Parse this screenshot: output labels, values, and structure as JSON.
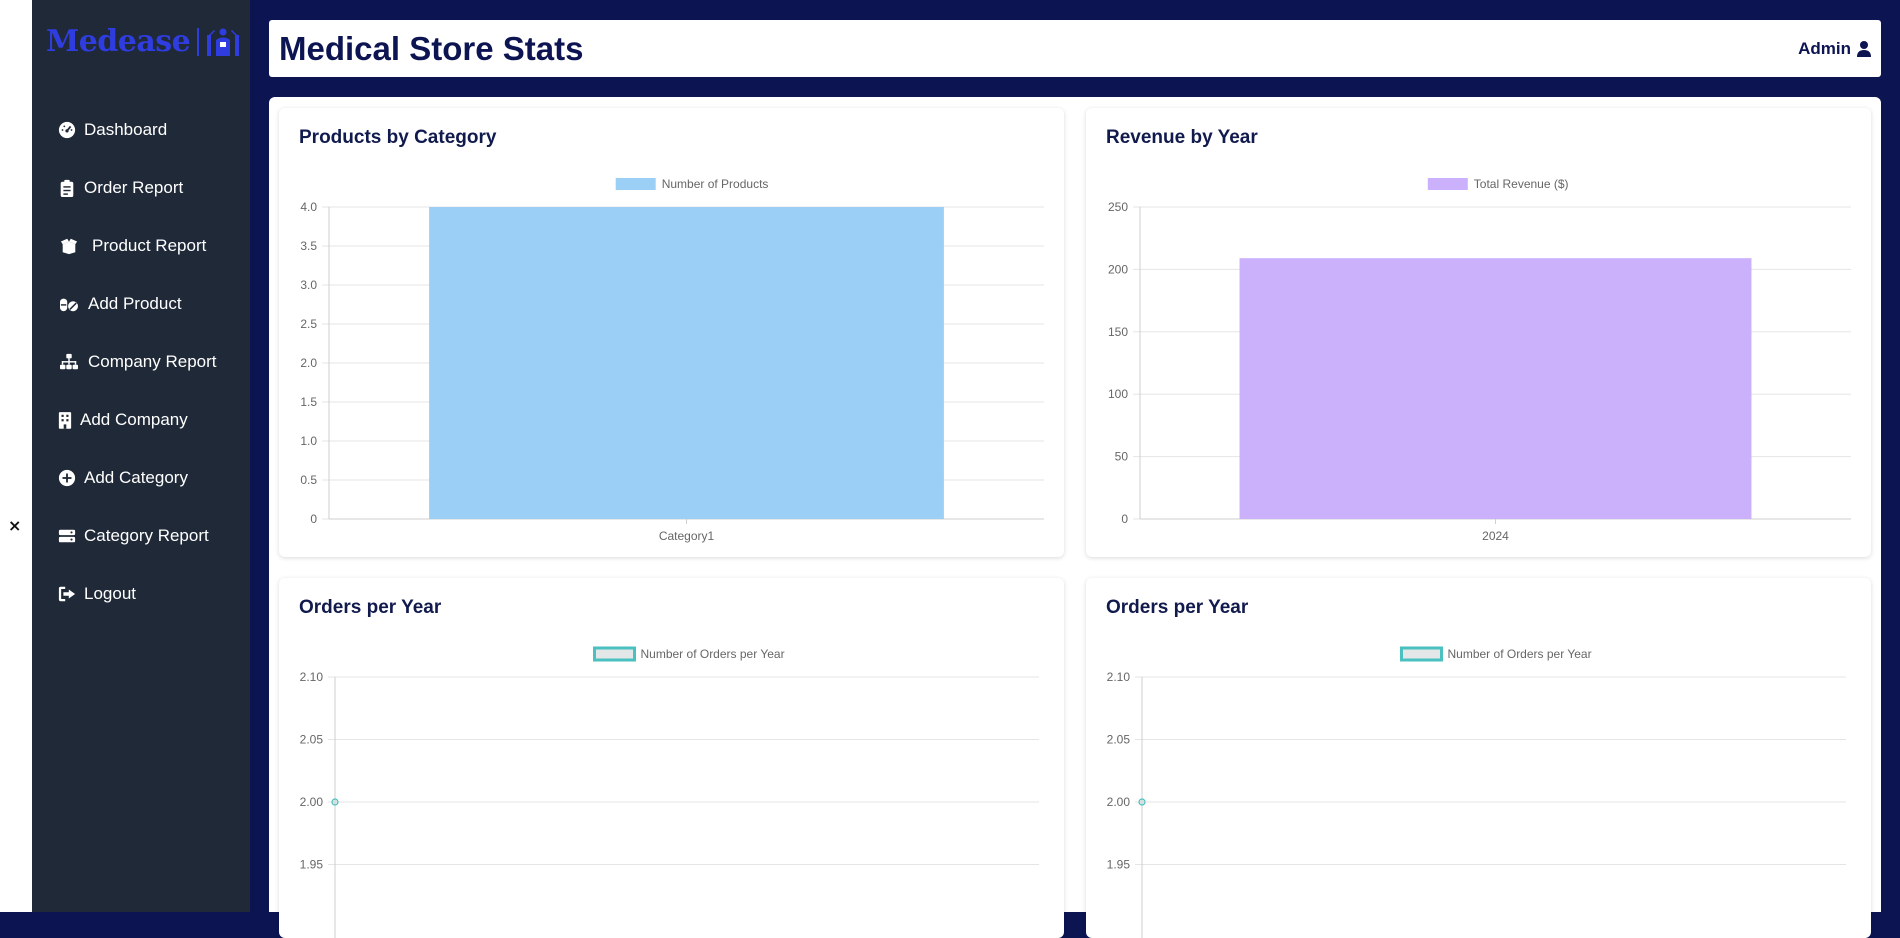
{
  "app": {
    "logo_text": "Medease",
    "close_label": "×"
  },
  "sidebar": {
    "items": [
      {
        "label": "Dashboard",
        "icon": "gauge-icon"
      },
      {
        "label": "Order Report",
        "icon": "clipboard-icon"
      },
      {
        "label": "Product Report",
        "icon": "box-open-icon"
      },
      {
        "label": "Add Product",
        "icon": "pills-icon"
      },
      {
        "label": "Company Report",
        "icon": "sitemap-icon"
      },
      {
        "label": "Add Company",
        "icon": "building-icon"
      },
      {
        "label": "Add Category",
        "icon": "plus-circle-icon"
      },
      {
        "label": "Category Report",
        "icon": "server-icon"
      },
      {
        "label": "Logout",
        "icon": "sign-out-icon"
      }
    ]
  },
  "header": {
    "title": "Medical Store Stats",
    "user": "Admin"
  },
  "colors": {
    "page_bg": "#0d1452",
    "sidebar_bg": "#1f2937",
    "logo": "#2f3de0",
    "bar_blue": "#9bcff5",
    "bar_purple": "#cbb0fc",
    "line_teal": "#4bc0c0"
  },
  "cards": [
    {
      "title": "Products by Category"
    },
    {
      "title": "Revenue by Year"
    },
    {
      "title": "Orders per Year"
    },
    {
      "title": "Orders per Year"
    }
  ],
  "chart_data": [
    {
      "type": "bar",
      "title": "Products by Category",
      "categories": [
        "Category1"
      ],
      "series": [
        {
          "name": "Number of Products",
          "values": [
            4
          ]
        }
      ],
      "ylim": [
        0,
        4
      ],
      "yticks": [
        "0",
        "0.5",
        "1.0",
        "1.5",
        "2.0",
        "2.5",
        "3.0",
        "3.5",
        "4.0"
      ],
      "color": "#9bcff5",
      "legend": "top-center",
      "grid": true
    },
    {
      "type": "bar",
      "title": "Revenue by Year",
      "categories": [
        "2024"
      ],
      "series": [
        {
          "name": "Total Revenue ($)",
          "values": [
            209
          ]
        }
      ],
      "ylim": [
        0,
        250
      ],
      "yticks": [
        "0",
        "50",
        "100",
        "150",
        "200",
        "250"
      ],
      "color": "#cbb0fc",
      "legend": "top-center",
      "grid": true
    },
    {
      "type": "line",
      "title": "Orders per Year",
      "series": [
        {
          "name": "Number of Orders per Year",
          "values": [
            2
          ]
        }
      ],
      "ylim": [
        1.9,
        2.1
      ],
      "yticks": [
        "2.10",
        "2.05",
        "2.00",
        "1.95"
      ],
      "color": "#4bc0c0",
      "legend": "top-center",
      "grid": true
    },
    {
      "type": "line",
      "title": "Orders per Year",
      "series": [
        {
          "name": "Number of Orders per Year",
          "values": [
            2
          ]
        }
      ],
      "ylim": [
        1.9,
        2.1
      ],
      "yticks": [
        "2.10",
        "2.05",
        "2.00",
        "1.95"
      ],
      "color": "#4bc0c0",
      "legend": "top-center",
      "grid": true
    }
  ]
}
